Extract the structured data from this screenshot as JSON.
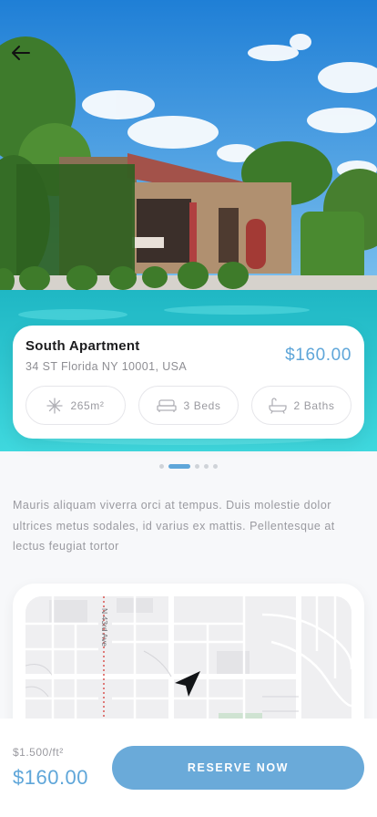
{
  "property": {
    "title": "South Apartment",
    "address": "34 ST Florida NY 10001, USA",
    "price": "$160.00"
  },
  "features": [
    {
      "icon": "area-icon",
      "label": "265m²"
    },
    {
      "icon": "bed-icon",
      "label": "3 Beds"
    },
    {
      "icon": "bathtub-icon",
      "label": "2 Baths"
    }
  ],
  "carousel": {
    "total": 5,
    "active": 1
  },
  "description": "Mauris aliquam viverra orci at tempus. Duis molestie dolor ultrices metus sodales, id varius ex mattis. Pellentesque at lectus feugiat tortor",
  "map": {
    "street_label": "N 43rd Ave"
  },
  "footer": {
    "unit_price": "$1.500/ft²",
    "total_price": "$160.00",
    "reserve_label": "RESERVE NOW"
  },
  "colors": {
    "accent": "#5fa6d9",
    "button": "#6aaad9"
  }
}
